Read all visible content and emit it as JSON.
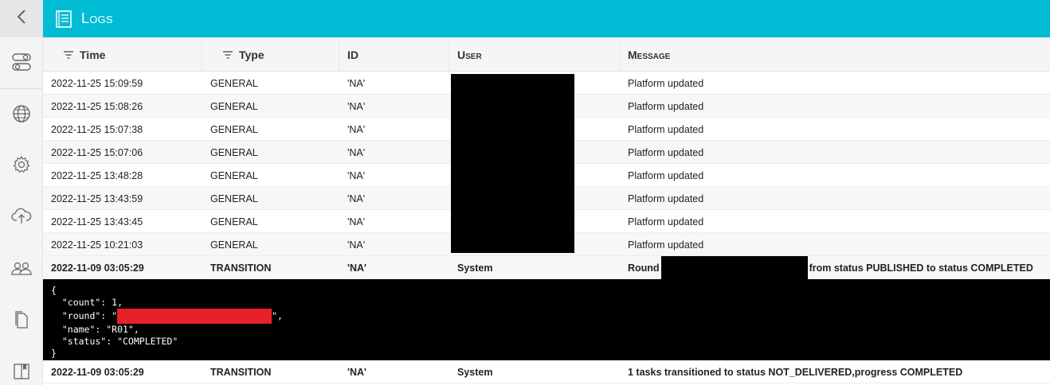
{
  "header": {
    "title": "Logs"
  },
  "sidebar": {
    "items": [
      {
        "icon": "toggle-icon"
      },
      {
        "icon": "globe-icon"
      },
      {
        "icon": "gear-icon"
      },
      {
        "icon": "cloud-upload-icon"
      },
      {
        "icon": "users-icon"
      },
      {
        "icon": "documents-icon"
      },
      {
        "icon": "book-icon"
      }
    ]
  },
  "table": {
    "columns": [
      "Time",
      "Type",
      "ID",
      "User",
      "Message"
    ],
    "rows": [
      {
        "time": "2022-11-25 15:09:59",
        "type": "GENERAL",
        "id": "'NA'",
        "user": "",
        "message": "Platform updated"
      },
      {
        "time": "2022-11-25 15:08:26",
        "type": "GENERAL",
        "id": "'NA'",
        "user": "",
        "message": "Platform updated"
      },
      {
        "time": "2022-11-25 15:07:38",
        "type": "GENERAL",
        "id": "'NA'",
        "user": "",
        "message": "Platform updated"
      },
      {
        "time": "2022-11-25 15:07:06",
        "type": "GENERAL",
        "id": "'NA'",
        "user": "",
        "message": "Platform updated"
      },
      {
        "time": "2022-11-25 13:48:28",
        "type": "GENERAL",
        "id": "'NA'",
        "user": "",
        "message": "Platform updated"
      },
      {
        "time": "2022-11-25 13:43:59",
        "type": "GENERAL",
        "id": "'NA'",
        "user": "",
        "message": "Platform updated"
      },
      {
        "time": "2022-11-25 13:43:45",
        "type": "GENERAL",
        "id": "'NA'",
        "user": "",
        "message": "Platform updated"
      },
      {
        "time": "2022-11-25 10:21:03",
        "type": "GENERAL",
        "id": "'NA'",
        "user": "",
        "message": "Platform updated"
      }
    ],
    "transition_row_1": {
      "time": "2022-11-09 03:05:29",
      "type": "TRANSITION",
      "id": "'NA'",
      "user": "System",
      "message_prefix": "Round",
      "message_suffix": "from status PUBLISHED to status COMPLETED"
    },
    "json_detail": {
      "open": "{",
      "count": "  \"count\": 1,",
      "round_prefix": "  \"round\": \"",
      "round_suffix": "\",",
      "name": "  \"name\": \"R01\",",
      "status": "  \"status\": \"COMPLETED\"",
      "close": "}"
    },
    "transition_row_2": {
      "time": "2022-11-09 03:05:29",
      "type": "TRANSITION",
      "id": "'NA'",
      "user": "System",
      "message": "1 tasks transitioned to status NOT_DELIVERED,progress COMPLETED"
    }
  }
}
